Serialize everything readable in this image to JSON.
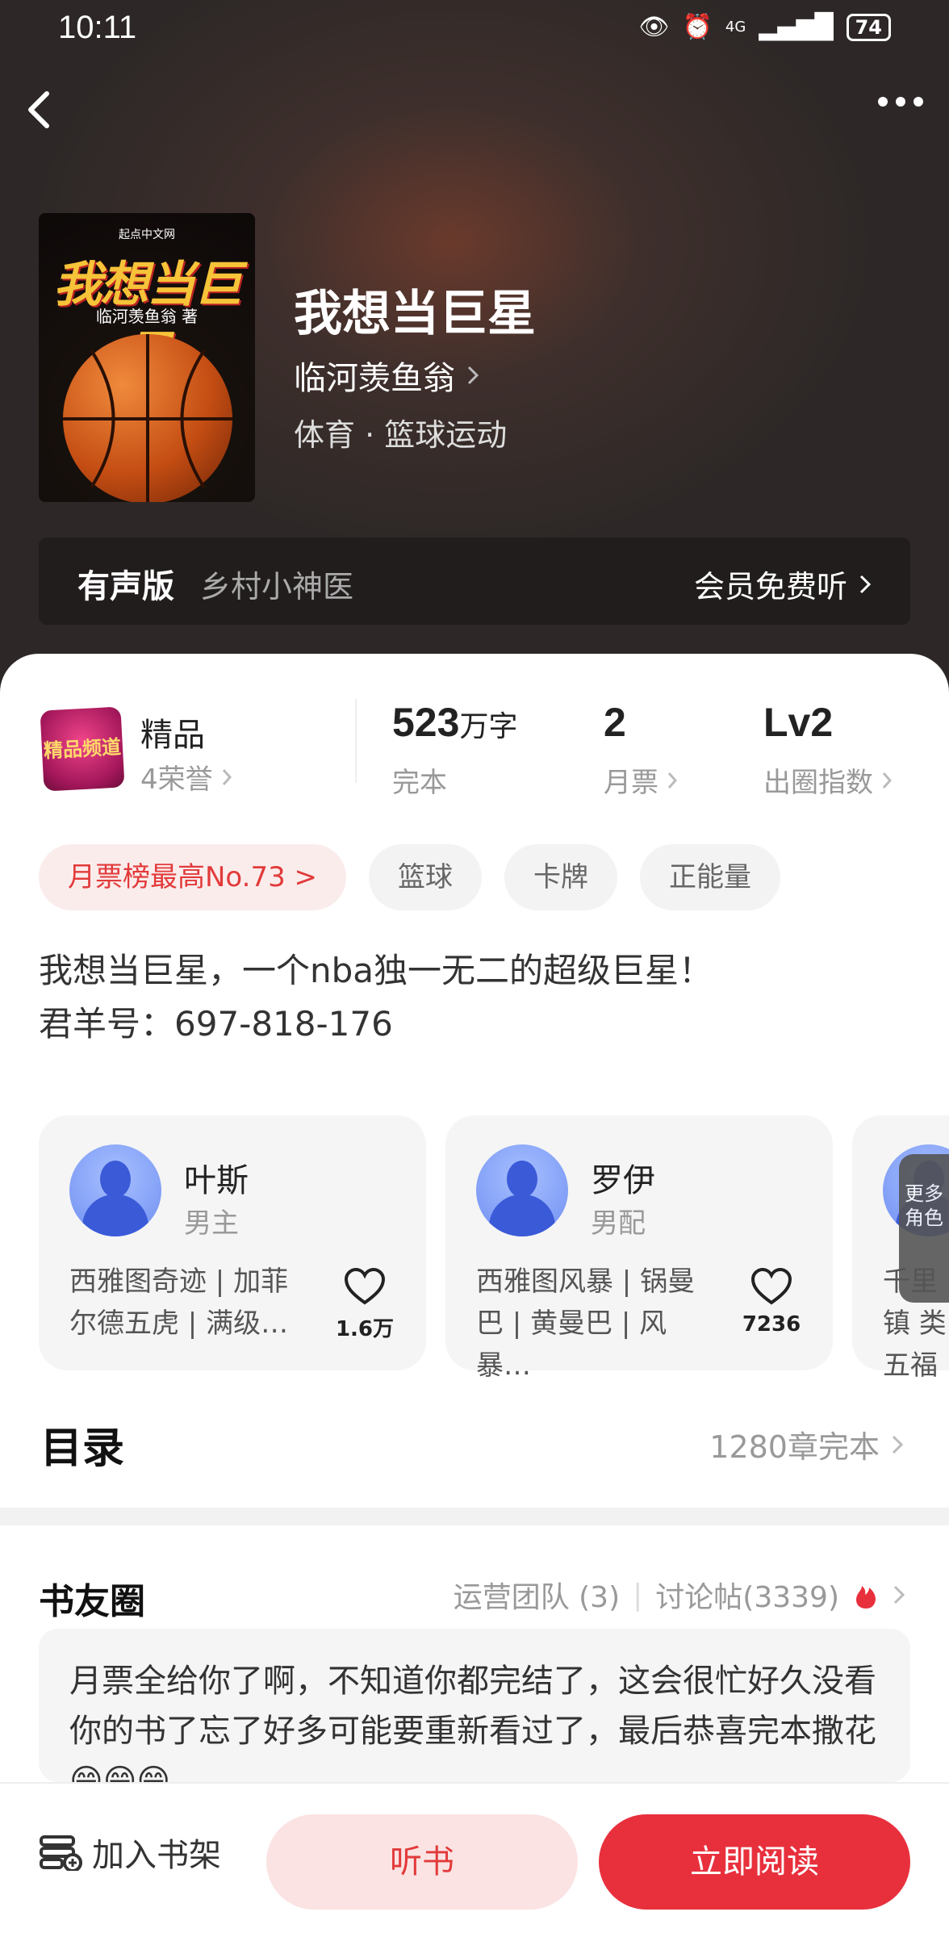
{
  "status": {
    "time": "10:11",
    "network": "4G",
    "battery": "74"
  },
  "book": {
    "cover_brand": "起点中文网",
    "cover_title": "我想当巨星",
    "cover_author": "临河羡鱼翁 著",
    "title": "我想当巨星",
    "author": "临河羡鱼翁",
    "genre": "体育 · 篮球运动"
  },
  "audio": {
    "label": "有声版",
    "sub": "乡村小神医",
    "cta": "会员免费听"
  },
  "badge": {
    "text": "精品频道"
  },
  "stats": {
    "quality_label": "精品",
    "honors": "4荣誉",
    "words_num": "523",
    "words_unit": "万字",
    "words_sub": "完本",
    "tickets_num": "2",
    "tickets_sub": "月票",
    "level_num": "Lv2",
    "level_sub": "出圈指数"
  },
  "tags": [
    "月票榜最高No.73 >",
    "篮球",
    "卡牌",
    "正能量"
  ],
  "description": {
    "line1": "我想当巨星，一个nba独一无二的超级巨星！",
    "line2": "君羊号：697-818-176"
  },
  "characters": [
    {
      "name": "叶斯",
      "role": "男主",
      "desc": "西雅图奇迹 | 加菲尔德五虎 | 满级…",
      "likes": "1.6万"
    },
    {
      "name": "罗伊",
      "role": "男配",
      "desc": "西雅图风暴 | 锅曼巴 | 黄曼巴 | 风暴…",
      "likes": "7236"
    },
    {
      "desc": "千里镇 类五福"
    }
  ],
  "more_characters": "更多角色",
  "catalog": {
    "title": "目录",
    "meta": "1280章完本"
  },
  "circle": {
    "title": "书友圈",
    "team": "运营团队 (3)",
    "posts": "讨论帖(3339)",
    "post_text": "月票全给你了啊，不知道你都完结了，这会很忙好久没看你的书了忘了好多可能要重新看过了，最后恭喜完本撒花😁😁😁"
  },
  "bottom": {
    "shelf": "加入书架",
    "listen": "听书",
    "read": "立即阅读"
  },
  "colors": {
    "accent": "#e8303d",
    "accent_light": "#fbe3e3",
    "tag_hot_text": "#e23a3a"
  }
}
